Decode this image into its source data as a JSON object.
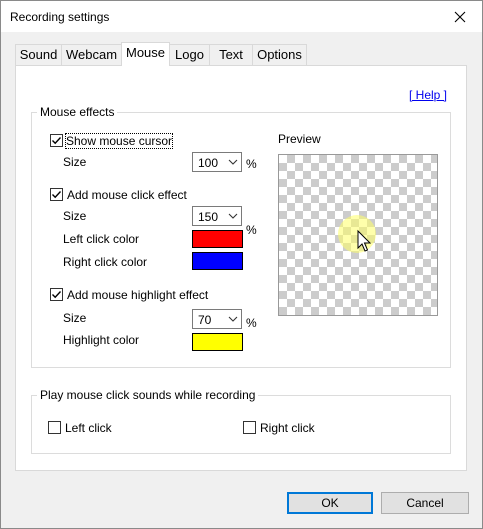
{
  "window": {
    "title": "Recording settings"
  },
  "tabs": [
    {
      "label": "Sound",
      "active": false
    },
    {
      "label": "Webcam",
      "active": false
    },
    {
      "label": "Mouse",
      "active": true
    },
    {
      "label": "Logo",
      "active": false
    },
    {
      "label": "Text",
      "active": false
    },
    {
      "label": "Options",
      "active": false
    }
  ],
  "help_link": "[ Help ]",
  "mouse_effects": {
    "title": "Mouse effects",
    "show_cursor": {
      "label": "Show mouse cursor",
      "checked": true,
      "size_label": "Size",
      "size_value": "100",
      "unit": "%"
    },
    "click_effect": {
      "label": "Add mouse click effect",
      "checked": true,
      "size_label": "Size",
      "size_value": "150",
      "unit": "%",
      "left_label": "Left click color",
      "left_color": "#ff0000",
      "right_label": "Right click color",
      "right_color": "#0000ff"
    },
    "highlight": {
      "label": "Add mouse highlight effect",
      "checked": true,
      "size_label": "Size",
      "size_value": "70",
      "unit": "%",
      "color_label": "Highlight color",
      "color": "#ffff00"
    },
    "preview_label": "Preview"
  },
  "sounds": {
    "title": "Play mouse click sounds while recording",
    "left": {
      "label": "Left click",
      "checked": false
    },
    "right": {
      "label": "Right click",
      "checked": false
    }
  },
  "buttons": {
    "ok": "OK",
    "cancel": "Cancel"
  }
}
